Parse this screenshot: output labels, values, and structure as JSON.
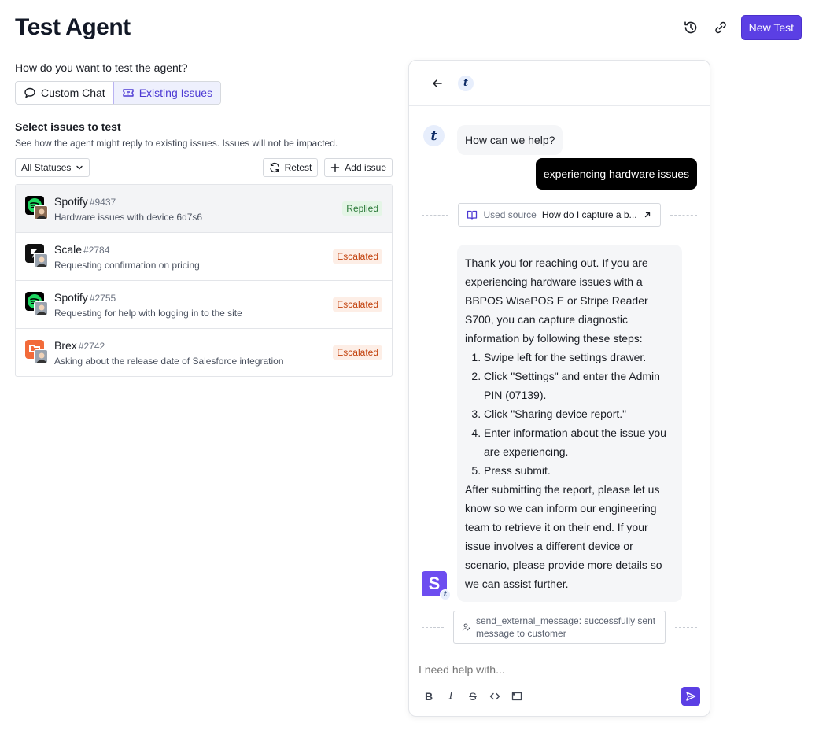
{
  "header": {
    "title": "Test Agent",
    "history_icon": "history-icon",
    "link_icon": "link-icon",
    "new_test_label": "New Test"
  },
  "mode": {
    "question": "How do you want to test the agent?",
    "custom_chat_label": "Custom Chat",
    "existing_issues_label": "Existing Issues",
    "active": "Existing Issues"
  },
  "issues_section": {
    "title": "Select issues to test",
    "subtitle": "See how the agent might reply to existing issues. Issues will not be impacted.",
    "status_filter": "All Statuses",
    "retest_label": "Retest",
    "add_issue_label": "Add issue"
  },
  "issues": [
    {
      "company": "Spotify",
      "number": "#9437",
      "description": "Hardware issues with device 6d7s6",
      "status": "Replied",
      "selected": true
    },
    {
      "company": "Scale",
      "number": "#2784",
      "description": "Requesting confirmation on pricing",
      "status": "Escalated",
      "selected": false
    },
    {
      "company": "Spotify",
      "number": "#2755",
      "description": "Requesting for help with logging in to the site",
      "status": "Escalated",
      "selected": false
    },
    {
      "company": "Brex",
      "number": "#2742",
      "description": "Asking about the release date of Salesforce integration",
      "status": "Escalated",
      "selected": false
    }
  ],
  "chat": {
    "logo_letter": "t",
    "greeting": "How can we help?",
    "user_message": "experiencing hardware issues",
    "source": {
      "prefix": "Used source",
      "title": "How do I capture a b..."
    },
    "reply": {
      "intro": "Thank you for reaching out. If you are experiencing hardware issues with a BBPOS WisePOS E or Stripe Reader S700, you can capture diagnostic information by following these steps:",
      "steps": [
        "Swipe left for the settings drawer.",
        "Click \"Settings\" and enter the Admin PIN (07139).",
        "Click \"Sharing device report.\"",
        "Enter information about the issue you are experiencing.",
        "Press submit."
      ],
      "outro": "After submitting the report, please let us know so we can inform our engineering team to retrieve it on their end. If your issue involves a different device or scenario, please provide more details so we can assist further."
    },
    "agent_avatar_letter": "S",
    "action_log": "send_external_message: successfully sent message to customer",
    "composer_placeholder": "I need help with...",
    "format_tools": [
      "B",
      "I",
      "S"
    ]
  },
  "colors": {
    "accent": "#5b3fe4",
    "replied_bg": "#e4f5e6",
    "replied_text": "#2d7a3a",
    "escalated_bg": "#fdeee6",
    "escalated_text": "#c2410c"
  }
}
